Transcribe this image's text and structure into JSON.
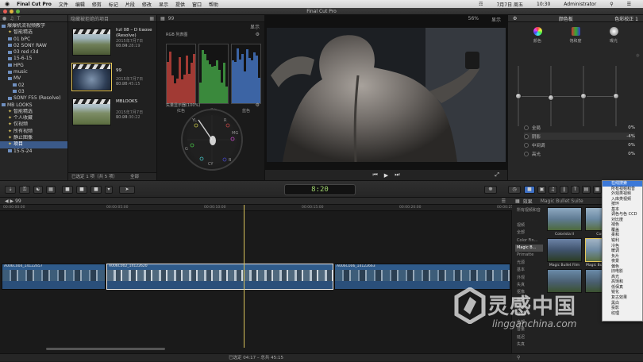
{
  "menubar": {
    "apple": "",
    "items": [
      "Final Cut Pro",
      "文件",
      "编辑",
      "修剪",
      "标记",
      "片段",
      "修改",
      "显示",
      "提供",
      "窗口",
      "帮助"
    ],
    "status": [
      "7月7日 周五",
      "10:30",
      "Administrator"
    ]
  },
  "window": {
    "title": "Final Cut Pro"
  },
  "library": {
    "items": [
      {
        "label": "爆爆机流视频教学",
        "type": "library",
        "selected": false
      },
      {
        "label": "智能精选",
        "type": "smart"
      },
      {
        "label": "01 bPC",
        "type": "folder"
      },
      {
        "label": "02 SONY RAW",
        "type": "folder"
      },
      {
        "label": "03 red r3d",
        "type": "folder"
      },
      {
        "label": "15-6-15",
        "type": "folder"
      },
      {
        "label": "HPG",
        "type": "folder"
      },
      {
        "label": "music",
        "type": "folder"
      },
      {
        "label": "MV",
        "type": "folder"
      },
      {
        "label": "02",
        "type": "event"
      },
      {
        "label": "03",
        "type": "event"
      },
      {
        "label": "SONY F55 (Resolve)",
        "type": "folder"
      },
      {
        "label": "MB LOOKS",
        "type": "library"
      },
      {
        "label": "智能精选",
        "type": "smart"
      },
      {
        "label": "个人收藏",
        "type": "smart"
      },
      {
        "label": "仅视频",
        "type": "smart"
      },
      {
        "label": "所有视频",
        "type": "smart"
      },
      {
        "label": "静止图像",
        "type": "smart"
      },
      {
        "label": "项目",
        "type": "smart",
        "selected": true
      },
      {
        "label": "15-5-24",
        "type": "event"
      }
    ]
  },
  "browser": {
    "header": "隐藏被拒绝的项目",
    "clips": [
      {
        "name": "hzl 08 – D tiaose (Resolve)",
        "date": "2015年7月7日 06:54",
        "duration": "00:00:28:19",
        "selected": false
      },
      {
        "name": "99",
        "date": "2015年7月7日 10:26",
        "duration": "00:00:45:15",
        "selected": true
      },
      {
        "name": "MBLOOKS",
        "date": "2015年7月7日 10:24",
        "duration": "00:00:30:22",
        "selected": false
      }
    ],
    "footer": "已选定 1 项（共 5 项）",
    "footer_right": "全部"
  },
  "scopes": {
    "title": "99",
    "display_label": "显示",
    "rgb_label": "RGB 列表图",
    "parade_labels": [
      "红色",
      "绿色",
      "蓝色"
    ],
    "vector_label": "矢量显示器(100%)",
    "vector_marks": [
      "R",
      "YL",
      "G",
      "CY",
      "B",
      "MG"
    ]
  },
  "viewer": {
    "zoom": "56%",
    "display_label": "显示"
  },
  "inspector": {
    "title": "颜色板",
    "right_title": "色彩校正 1",
    "tabs": [
      "颜色",
      "饱和度",
      "曝光"
    ],
    "params": [
      {
        "label": "全局",
        "value": "0%"
      },
      {
        "label": "阴影",
        "value": "-4%"
      },
      {
        "label": "中间调",
        "value": "0%"
      },
      {
        "label": "高光",
        "value": "0%"
      }
    ]
  },
  "toolbar": {
    "timecode": "8:20",
    "timecode_sub": "HR  MIN  SEC  FR"
  },
  "timeline": {
    "project": "99",
    "ruler": [
      "00:00:00:00",
      "00:00:05:00",
      "00:00:10:00",
      "00:00:15:00",
      "00:00:20:00",
      "00:00:25:00"
    ],
    "clips": [
      {
        "label": "A006C004_14122657",
        "selected": false
      },
      {
        "label": "A006C002_14122620",
        "selected": true
      },
      {
        "label": "A006C006_14122663",
        "selected": false
      }
    ],
    "footer": "已选定 04:17 – 总共 45:15"
  },
  "effects": {
    "header": "效果",
    "title": "Magic Bullet Suite",
    "categories": [
      "所有视频和音",
      "",
      "视频",
      "全部",
      "Color Fin...",
      "Magic B...",
      "Primatte",
      "光源",
      "基本",
      "外观",
      "失真",
      "抠像",
      "拼贴",
      "颜色",
      "音频",
      "全部",
      "音量",
      "延迟",
      "失真"
    ],
    "thumbs": [
      {
        "label": "Colorista II"
      },
      {
        "label": "Cosmo"
      },
      {
        "label": "Magic Bullet Film"
      },
      {
        "label": "Magic Bullet Looks"
      },
      {
        "label": ""
      },
      {
        "label": ""
      }
    ]
  },
  "dropdown": {
    "items": [
      "在线搜索",
      "所有视频和音",
      "外观类视频",
      "入库类视频",
      "按环",
      "基本",
      "调色与色 CCD",
      "对比度",
      "褪色",
      "覆盖",
      "柔和",
      "锐利",
      "冷色",
      "暖调",
      "负片",
      "夜景",
      "偏色",
      "旧电影",
      "高光",
      "高饱和",
      "低保真",
      "锐化",
      "复古效果",
      "黑白",
      "投影",
      "纹理"
    ],
    "highlight_index": 0
  },
  "watermark": {
    "text": "灵感中国",
    "url": "lingganchina.com"
  }
}
